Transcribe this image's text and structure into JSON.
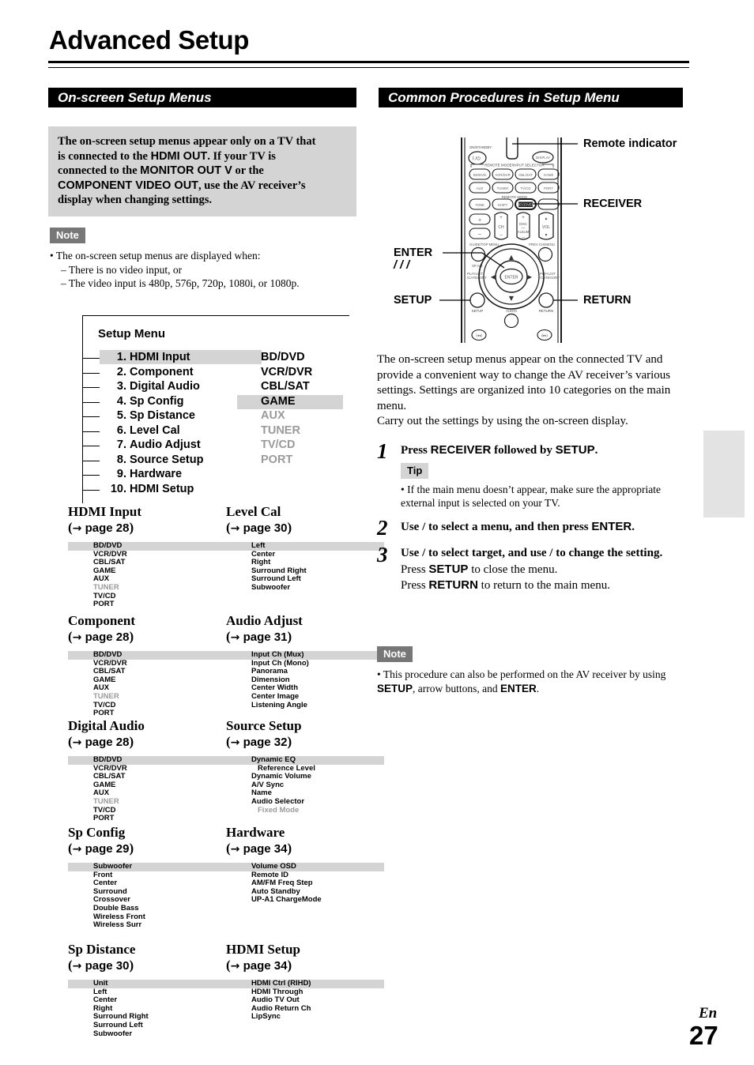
{
  "page_title": "Advanced Setup",
  "sections": {
    "left_banner": "On-screen Setup Menus",
    "right_banner": "Common Procedures in Setup Menu"
  },
  "callout": {
    "l1a": "The on-screen setup menus appear only on a TV that",
    "l2a": "is connected to the ",
    "l2b": "HDMI OUT",
    "l2c": ". If your TV is",
    "l3a": "connected to the ",
    "l3b": "MONITOR OUT V",
    "l3c": " or the",
    "l4a": "COMPONENT VIDEO OUT",
    "l4b": ", use the AV receiver’s",
    "l5": "display when changing settings."
  },
  "note_left": {
    "tag": "Note",
    "line1": "• The on-screen setup menus are displayed when:",
    "line2": "– There is no video input, or",
    "line3": "– The video input is 480p, 576p, 720p, 1080i, or 1080p."
  },
  "setup_menu": {
    "title": "Setup Menu",
    "items": [
      {
        "num": "1.",
        "label": "HDMI Input",
        "highlighted": true
      },
      {
        "num": "2.",
        "label": "Component",
        "highlighted": false
      },
      {
        "num": "3.",
        "label": "Digital Audio",
        "highlighted": false
      },
      {
        "num": "4.",
        "label": "Sp Config",
        "highlighted": false
      },
      {
        "num": "5.",
        "label": "Sp Distance",
        "highlighted": false
      },
      {
        "num": "6.",
        "label": "Level Cal",
        "highlighted": false
      },
      {
        "num": "7.",
        "label": "Audio Adjust",
        "highlighted": false
      },
      {
        "num": "8.",
        "label": "Source Setup",
        "highlighted": false
      },
      {
        "num": "9.",
        "label": "Hardware",
        "highlighted": false
      },
      {
        "num": "10.",
        "label": "HDMI Setup",
        "highlighted": false
      }
    ],
    "sources": [
      {
        "label": "BD/DVD",
        "gray": false,
        "highlighted": false
      },
      {
        "label": "VCR/DVR",
        "gray": false,
        "highlighted": false
      },
      {
        "label": "CBL/SAT",
        "gray": false,
        "highlighted": false
      },
      {
        "label": "GAME",
        "gray": false,
        "highlighted": true
      },
      {
        "label": "AUX",
        "gray": true,
        "highlighted": false
      },
      {
        "label": "TUNER",
        "gray": true,
        "highlighted": false
      },
      {
        "label": "TV/CD",
        "gray": true,
        "highlighted": false
      },
      {
        "label": "PORT",
        "gray": true,
        "highlighted": false
      }
    ]
  },
  "blocks": [
    {
      "heading": "HDMI Input",
      "page": "page 28",
      "items": [
        {
          "label": "BD/DVD",
          "gray": false,
          "highlighted": true,
          "indent": false
        },
        {
          "label": "VCR/DVR",
          "gray": false,
          "highlighted": false,
          "indent": false
        },
        {
          "label": "CBL/SAT",
          "gray": false,
          "highlighted": false,
          "indent": false
        },
        {
          "label": "GAME",
          "gray": false,
          "highlighted": false,
          "indent": false
        },
        {
          "label": "AUX",
          "gray": false,
          "highlighted": false,
          "indent": false
        },
        {
          "label": "TUNER",
          "gray": true,
          "highlighted": false,
          "indent": false
        },
        {
          "label": "TV/CD",
          "gray": false,
          "highlighted": false,
          "indent": false
        },
        {
          "label": "PORT",
          "gray": false,
          "highlighted": false,
          "indent": false
        }
      ]
    },
    {
      "heading": "Level Cal",
      "page": "page 30",
      "items": [
        {
          "label": "Left",
          "gray": false,
          "highlighted": true,
          "indent": false
        },
        {
          "label": "Center",
          "gray": false,
          "highlighted": false,
          "indent": false
        },
        {
          "label": "Right",
          "gray": false,
          "highlighted": false,
          "indent": false
        },
        {
          "label": "Surround Right",
          "gray": false,
          "highlighted": false,
          "indent": false
        },
        {
          "label": "Surround Left",
          "gray": false,
          "highlighted": false,
          "indent": false
        },
        {
          "label": "Subwoofer",
          "gray": false,
          "highlighted": false,
          "indent": false
        }
      ]
    },
    {
      "heading": "Component",
      "page": "page 28",
      "items": [
        {
          "label": "BD/DVD",
          "gray": false,
          "highlighted": true,
          "indent": false
        },
        {
          "label": "VCR/DVR",
          "gray": false,
          "highlighted": false,
          "indent": false
        },
        {
          "label": "CBL/SAT",
          "gray": false,
          "highlighted": false,
          "indent": false
        },
        {
          "label": "GAME",
          "gray": false,
          "highlighted": false,
          "indent": false
        },
        {
          "label": "AUX",
          "gray": false,
          "highlighted": false,
          "indent": false
        },
        {
          "label": "TUNER",
          "gray": true,
          "highlighted": false,
          "indent": false
        },
        {
          "label": "TV/CD",
          "gray": false,
          "highlighted": false,
          "indent": false
        },
        {
          "label": "PORT",
          "gray": false,
          "highlighted": false,
          "indent": false
        }
      ]
    },
    {
      "heading": "Audio Adjust",
      "page": "page 31",
      "items": [
        {
          "label": "Input Ch (Mux)",
          "gray": false,
          "highlighted": true,
          "indent": false
        },
        {
          "label": "Input Ch (Mono)",
          "gray": false,
          "highlighted": false,
          "indent": false
        },
        {
          "label": "Panorama",
          "gray": false,
          "highlighted": false,
          "indent": false
        },
        {
          "label": "Dimension",
          "gray": false,
          "highlighted": false,
          "indent": false
        },
        {
          "label": "Center Width",
          "gray": false,
          "highlighted": false,
          "indent": false
        },
        {
          "label": "Center Image",
          "gray": false,
          "highlighted": false,
          "indent": false
        },
        {
          "label": "Listening Angle",
          "gray": false,
          "highlighted": false,
          "indent": false
        }
      ]
    },
    {
      "heading": "Digital Audio",
      "page": "page 28",
      "items": [
        {
          "label": "BD/DVD",
          "gray": false,
          "highlighted": true,
          "indent": false
        },
        {
          "label": "VCR/DVR",
          "gray": false,
          "highlighted": false,
          "indent": false
        },
        {
          "label": "CBL/SAT",
          "gray": false,
          "highlighted": false,
          "indent": false
        },
        {
          "label": "GAME",
          "gray": false,
          "highlighted": false,
          "indent": false
        },
        {
          "label": "AUX",
          "gray": false,
          "highlighted": false,
          "indent": false
        },
        {
          "label": "TUNER",
          "gray": true,
          "highlighted": false,
          "indent": false
        },
        {
          "label": "TV/CD",
          "gray": false,
          "highlighted": false,
          "indent": false
        },
        {
          "label": "PORT",
          "gray": false,
          "highlighted": false,
          "indent": false
        }
      ]
    },
    {
      "heading": "Source Setup",
      "page": "page 32",
      "items": [
        {
          "label": "Dynamic EQ",
          "gray": false,
          "highlighted": true,
          "indent": false
        },
        {
          "label": "Reference Level",
          "gray": false,
          "highlighted": false,
          "indent": true
        },
        {
          "label": "Dynamic Volume",
          "gray": false,
          "highlighted": false,
          "indent": false
        },
        {
          "label": "A/V Sync",
          "gray": false,
          "highlighted": false,
          "indent": false
        },
        {
          "label": "Name",
          "gray": false,
          "highlighted": false,
          "indent": false
        },
        {
          "label": "Audio Selector",
          "gray": false,
          "highlighted": false,
          "indent": false
        },
        {
          "label": "Fixed Mode",
          "gray": true,
          "highlighted": false,
          "indent": true
        }
      ]
    },
    {
      "heading": "Sp Config",
      "page": "page 29",
      "items": [
        {
          "label": "Subwoofer",
          "gray": false,
          "highlighted": true,
          "indent": false
        },
        {
          "label": "Front",
          "gray": false,
          "highlighted": false,
          "indent": false
        },
        {
          "label": "Center",
          "gray": false,
          "highlighted": false,
          "indent": false
        },
        {
          "label": "Surround",
          "gray": false,
          "highlighted": false,
          "indent": false
        },
        {
          "label": "Crossover",
          "gray": false,
          "highlighted": false,
          "indent": false
        },
        {
          "label": "Double Bass",
          "gray": false,
          "highlighted": false,
          "indent": false
        },
        {
          "label": "Wireless Front",
          "gray": false,
          "highlighted": false,
          "indent": false
        },
        {
          "label": "Wireless Surr",
          "gray": false,
          "highlighted": false,
          "indent": false
        }
      ]
    },
    {
      "heading": "Hardware",
      "page": "page 34",
      "items": [
        {
          "label": "Volume OSD",
          "gray": false,
          "highlighted": true,
          "indent": false
        },
        {
          "label": "Remote ID",
          "gray": false,
          "highlighted": false,
          "indent": false
        },
        {
          "label": "AM/FM Freq Step",
          "gray": false,
          "highlighted": false,
          "indent": false
        },
        {
          "label": "Auto Standby",
          "gray": false,
          "highlighted": false,
          "indent": false
        },
        {
          "label": "UP-A1 ChargeMode",
          "gray": false,
          "highlighted": false,
          "indent": false
        }
      ]
    },
    {
      "heading": "Sp Distance",
      "page": "page 30",
      "items": [
        {
          "label": "Unit",
          "gray": false,
          "highlighted": true,
          "indent": false
        },
        {
          "label": "Left",
          "gray": false,
          "highlighted": false,
          "indent": false
        },
        {
          "label": "Center",
          "gray": false,
          "highlighted": false,
          "indent": false
        },
        {
          "label": "Right",
          "gray": false,
          "highlighted": false,
          "indent": false
        },
        {
          "label": "Surround Right",
          "gray": false,
          "highlighted": false,
          "indent": false
        },
        {
          "label": "Surround Left",
          "gray": false,
          "highlighted": false,
          "indent": false
        },
        {
          "label": "Subwoofer",
          "gray": false,
          "highlighted": false,
          "indent": false
        }
      ]
    },
    {
      "heading": "HDMI Setup",
      "page": "page 34",
      "items": [
        {
          "label": "HDMI Ctrl (RIHD)",
          "gray": false,
          "highlighted": true,
          "indent": false
        },
        {
          "label": "HDMI Through",
          "gray": false,
          "highlighted": false,
          "indent": false
        },
        {
          "label": "Audio TV Out",
          "gray": false,
          "highlighted": false,
          "indent": false
        },
        {
          "label": "Audio Return Ch",
          "gray": false,
          "highlighted": false,
          "indent": false
        },
        {
          "label": "LipSync",
          "gray": false,
          "highlighted": false,
          "indent": false
        }
      ]
    }
  ],
  "remote": {
    "labels": {
      "remote_indicator": "Remote indicator",
      "receiver": "RECEIVER",
      "enter": "ENTER",
      "enter_arrows": "/  /  /",
      "setup": "SETUP",
      "return": "RETURN"
    },
    "buttons": {
      "onstandby": "ON/STANDBY",
      "power": "Ⅰ/⏻",
      "display": "DISPLAY",
      "mode_selector": "REMOTE MODE/INPUT SELECTOR",
      "bd_dvd": "BD/DVD",
      "vcr_dvr": "VCR/DVR",
      "cbl_sat": "CBL/SAT",
      "game": "GAME",
      "aux": "AUX",
      "tuner": "TUNER",
      "tv_cd": "TV/CD",
      "port": "PORT",
      "remote_mode": "REMOTE MODE",
      "tone": "TONE",
      "shift": "SHIFT",
      "receiver_btn": "RECEIVER",
      "ch": "CH",
      "disc": "DISC",
      "album": "ALBUM",
      "vol": "VOL",
      "guide_top_menu": "GUIDE/TOP MENU",
      "sp_ab": "SP A/B",
      "prev_ch_menu": "PREV CH/MENU",
      "playlist_category_l": "PLAYLIST\n/CATEGORY",
      "playlist_category_r": "PLAYLIST\n/CATEGORY",
      "enter_btn": "ENTER",
      "setup_btn": "SETUP",
      "return_btn": "RETURN",
      "audio": "AUDIO"
    }
  },
  "intro": {
    "p1": "The on-screen setup menus appear on the connected TV and provide a convenient way to change the AV receiver’s various settings. Settings are organized into 10 categories on the main menu.",
    "p2": "Carry out the settings by using the on-screen display."
  },
  "steps": [
    {
      "num": "1",
      "t1": "Press ",
      "sans1": "RECEIVER",
      "t2": " followed by ",
      "sans2": "SETUP",
      "t3": ".",
      "tip_tag": "Tip",
      "tip_text": "• If the main menu doesn’t appear, make sure the appropriate external input is selected on your TV."
    },
    {
      "num": "2",
      "t1": "Use  /  to select a menu, and then press ",
      "sans1": "ENTER",
      "t2": "."
    },
    {
      "num": "3",
      "t1": "Use  /  to select target, and use  /  to change the setting.",
      "sub1a": "Press ",
      "sub1b": "SETUP",
      "sub1c": " to close the menu.",
      "sub2a": "Press ",
      "sub2b": "RETURN",
      "sub2c": " to return to the main menu."
    }
  ],
  "note_right": {
    "tag": "Note",
    "a": "• This procedure can also be performed on the AV receiver by using ",
    "b": "SETUP",
    "c": ", arrow buttons, and ",
    "d": "ENTER",
    "e": "."
  },
  "footer": {
    "lang": "En",
    "page_number": "27"
  }
}
